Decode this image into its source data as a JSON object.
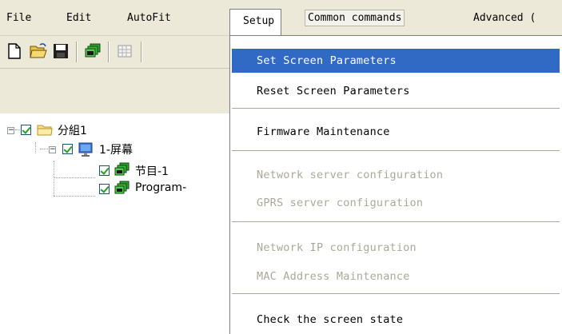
{
  "menubar": {
    "items": [
      "File",
      "Edit",
      "AutoFit",
      "Setup",
      "Common commands",
      "Advanced ("
    ]
  },
  "tree": {
    "group": "分組1",
    "screen": "1-屏幕",
    "program1": "节目-1",
    "program2": "Program-"
  },
  "setup_menu": {
    "items": [
      {
        "label": "Set Screen Parameters",
        "state": "selected"
      },
      {
        "label": "Reset Screen Parameters",
        "state": "enabled"
      },
      {
        "label": "Firmware Maintenance",
        "state": "enabled"
      },
      {
        "label": "Network server configuration",
        "state": "disabled"
      },
      {
        "label": "GPRS server configuration",
        "state": "disabled"
      },
      {
        "label": "Network IP configuration",
        "state": "disabled"
      },
      {
        "label": "MAC Address Maintenance",
        "state": "disabled"
      },
      {
        "label": "Check the screen state",
        "state": "enabled"
      }
    ]
  },
  "colors": {
    "menu_bg": "#ece9d8",
    "selection": "#316ac5",
    "disabled_text": "#aca899"
  }
}
